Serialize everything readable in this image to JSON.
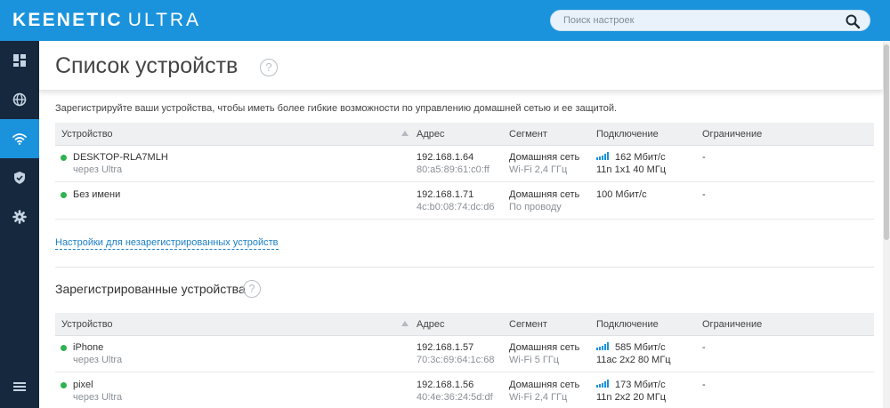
{
  "brand": {
    "name": "KEENETIC",
    "model": "ULTRA"
  },
  "search": {
    "placeholder": "Поиск настроек",
    "value": ""
  },
  "colors": {
    "topbar": "#1b93dc",
    "sidebar": "#16283e",
    "sidebar_active": "#1b93dc",
    "online": "#2fb24f",
    "link": "#1b7fc4"
  },
  "sidebar": {
    "items": [
      {
        "icon": "dashboard-icon",
        "active": false
      },
      {
        "icon": "globe-icon",
        "active": false
      },
      {
        "icon": "wifi-icon",
        "active": true
      },
      {
        "icon": "shield-icon",
        "active": false
      },
      {
        "icon": "gear-icon",
        "active": false
      },
      {
        "icon": "menu-icon",
        "active": false
      }
    ]
  },
  "page": {
    "title": "Список устройств",
    "help_symbol": "?"
  },
  "intro": "Зарегистрируйте ваши устройства, чтобы иметь более гибкие возможности по управлению домашней сетью и ее защитой.",
  "columns": [
    "Устройство",
    "Адрес",
    "Сегмент",
    "Подключение",
    "Ограничение"
  ],
  "unregistered": [
    {
      "name": "DESKTOP-RLA7MLH",
      "via": "через Ultra",
      "ip": "192.168.1.64",
      "mac": "80:a5:89:61:c0:ff",
      "segment": "Домашняя сеть",
      "medium": "Wi-Fi 2,4 ГГц",
      "speed": "162 Мбит/с",
      "mode": "11n 1x1 40 МГц",
      "wireless": true,
      "limit": "-"
    },
    {
      "name": "Без имени",
      "via": "",
      "ip": "192.168.1.71",
      "mac": "4c:b0:08:74:dc:d6",
      "segment": "Домашняя сеть",
      "medium": "По проводу",
      "speed": "100 Мбит/с",
      "mode": "",
      "wireless": false,
      "limit": "-"
    }
  ],
  "unregistered_link": "Настройки для незарегистрированных устройств",
  "registered_section": {
    "title": "Зарегистрированные устройства",
    "help_symbol": "?"
  },
  "registered": [
    {
      "name": "iPhone",
      "via": "через Ultra",
      "ip": "192.168.1.57",
      "mac": "70:3c:69:64:1c:68",
      "segment": "Домашняя сеть",
      "medium": "Wi-Fi 5 ГГц",
      "speed": "585 Мбит/с",
      "mode": "11ac 2x2 80 МГц",
      "wireless": true,
      "limit": "-"
    },
    {
      "name": "pixel",
      "via": "через Ultra",
      "ip": "192.168.1.56",
      "mac": "40:4e:36:24:5d:df",
      "segment": "Домашняя сеть",
      "medium": "Wi-Fi 2,4 ГГц",
      "speed": "173 Мбит/с",
      "mode": "11n 2x2 20 МГц",
      "wireless": true,
      "limit": "-"
    }
  ]
}
